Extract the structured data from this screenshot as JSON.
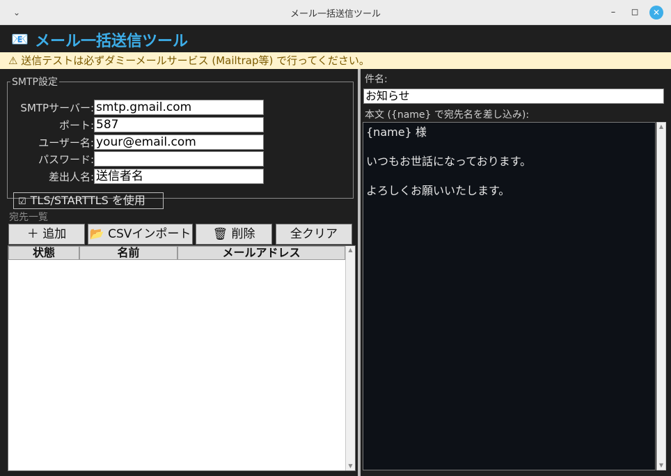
{
  "window": {
    "title": "メール一括送信ツール"
  },
  "header": {
    "icon": "📧",
    "title": "メール一括送信ツール"
  },
  "warning": {
    "text": "⚠ 送信テストは必ずダミーメールサービス (Mailtrap等) で行ってください。"
  },
  "smtp": {
    "legend": "SMTP設定",
    "server_label": "SMTPサーバー:",
    "server_value": "smtp.gmail.com",
    "port_label": "ポート:",
    "port_value": "587",
    "user_label": "ユーザー名:",
    "user_value": "your@email.com",
    "password_label": "パスワード:",
    "password_value": "",
    "sender_label": "差出人名:",
    "sender_value": "送信者名",
    "tls_checked": "☑",
    "tls_label": "TLS/STARTTLS を使用"
  },
  "recipients": {
    "label": "宛先一覧",
    "add_button": "＋ 追加",
    "csv_button": "📂 CSVインポート",
    "delete_button": "🗑 削除",
    "clear_button": "全クリア",
    "columns": [
      "状態",
      "名前",
      "メールアドレス"
    ]
  },
  "message": {
    "subject_label": "件名:",
    "subject_value": "お知らせ",
    "body_label": "本文 ({name} で宛先名を差し込み):",
    "body_value": "{name} 様\n\nいつもお世話になっております。\n\nよろしくお願いいたします。"
  },
  "icons": {
    "menu": "chevron-down-icon",
    "minimize": "minimize-icon",
    "maximize": "maximize-icon",
    "close": "close-icon"
  },
  "colors": {
    "accent": "#3daee9",
    "warning_bg": "#fff3cd",
    "warning_text": "#7a5a00",
    "app_bg": "#1f1f1f",
    "editor_bg": "#0d1117"
  }
}
